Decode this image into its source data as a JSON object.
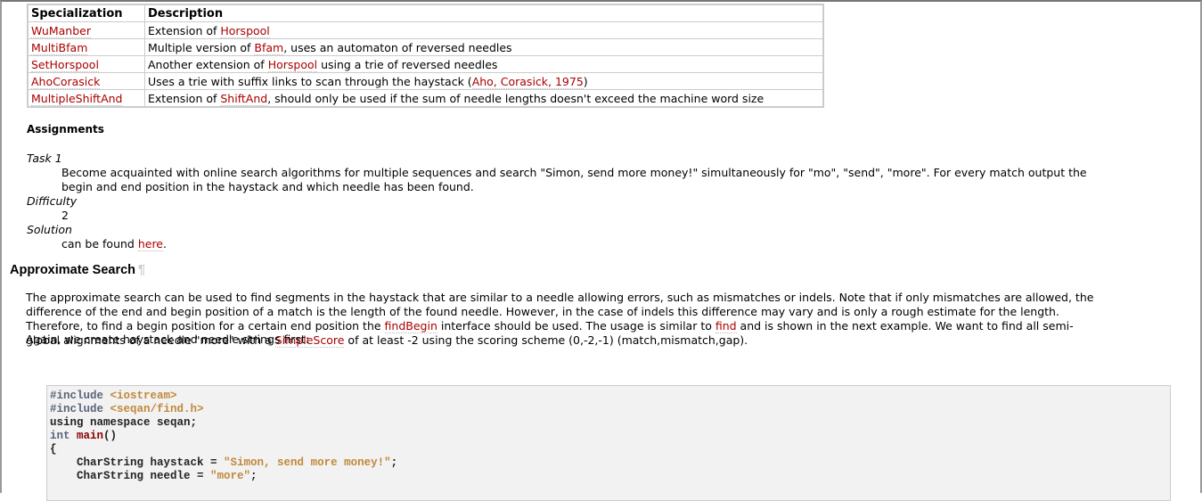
{
  "table": {
    "headers": [
      "Specialization",
      "Description"
    ],
    "rows": [
      {
        "name": "WuManber",
        "desc": [
          {
            "t": "Extension of "
          },
          {
            "t": "Horspool",
            "link": true
          }
        ]
      },
      {
        "name": "MultiBfam",
        "desc": [
          {
            "t": "Multiple version of "
          },
          {
            "t": "Bfam",
            "link": true
          },
          {
            "t": ", uses an automaton of reversed needles"
          }
        ]
      },
      {
        "name": "SetHorspool",
        "desc": [
          {
            "t": "Another extension of "
          },
          {
            "t": "Horspool",
            "link": true
          },
          {
            "t": " using a trie of reversed needles"
          }
        ]
      },
      {
        "name": "AhoCorasick",
        "desc": [
          {
            "t": "Uses a trie with suffix links to scan through the haystack ("
          },
          {
            "t": "Aho, Corasick, 1975",
            "link": true
          },
          {
            "t": ")"
          }
        ]
      },
      {
        "name": "MultipleShiftAnd",
        "desc": [
          {
            "t": "Extension of "
          },
          {
            "t": "ShiftAnd",
            "link": true
          },
          {
            "t": ", should only be used if the sum of needle lengths doesn't exceed the machine word size"
          }
        ]
      }
    ]
  },
  "assignments": {
    "title": "Assignments",
    "task_label": "Task 1",
    "task_lines": [
      "Become acquainted with online search algorithms for multiple sequences and search \"Simon, send more money!\" simultaneously for \"mo\", \"send\", \"more\". For every match output the",
      "begin and end position in the haystack and which needle has been found."
    ],
    "difficulty_label": "Difficulty",
    "difficulty": "2",
    "solution_label": "Solution",
    "solution_text": "can be found ",
    "solution_link": "here",
    "solution_end": "."
  },
  "section": {
    "title": "Approximate Search",
    "pilcrow": "¶",
    "para_lines": [
      [
        {
          "t": "The approximate search can be used to find segments in the haystack that are similar to a needle allowing errors, such as mismatches or indels. Note that if only mismatches are allowed, the"
        }
      ],
      [
        {
          "t": "difference of the end and begin position of a match is the length of the found needle. However, in the case of indels this difference may vary and is only a rough estimate for the length."
        }
      ],
      [
        {
          "t": "Therefore, to find a begin position for a certain end position the "
        },
        {
          "t": "findBegin",
          "link": true
        },
        {
          "t": " interface should be used. The usage is similar to "
        },
        {
          "t": "find",
          "link": true
        },
        {
          "t": " and is shown in the next example. We want to find all semi-"
        }
      ],
      [
        {
          "t": "global alignments of a needle \"more\" with a "
        },
        {
          "t": "SimpleScore",
          "link": true
        },
        {
          "t": " of at least -2 using the scoring scheme (0,-2,-1) (match,mismatch,gap)."
        }
      ]
    ],
    "again": "Again, we create haystack and needle strings first:"
  },
  "code": [
    [
      {
        "t": "#include ",
        "c": "kw"
      },
      {
        "t": "<iostream>",
        "c": "str"
      }
    ],
    [
      {
        "t": "#include ",
        "c": "kw"
      },
      {
        "t": "<seqan/find.h>",
        "c": "str"
      }
    ],
    [
      {
        "t": "using namespace seqan;"
      }
    ],
    [
      {
        "t": "int ",
        "c": "kw"
      },
      {
        "t": "main",
        "c": "fn"
      },
      {
        "t": "()"
      }
    ],
    [
      {
        "t": "{"
      }
    ],
    [
      {
        "t": "    CharString haystack = "
      },
      {
        "t": "\"Simon, send more money!\"",
        "c": "str"
      },
      {
        "t": ";"
      }
    ],
    [
      {
        "t": "    CharString needle = "
      },
      {
        "t": "\"more\"",
        "c": "str"
      },
      {
        "t": ";"
      }
    ]
  ]
}
